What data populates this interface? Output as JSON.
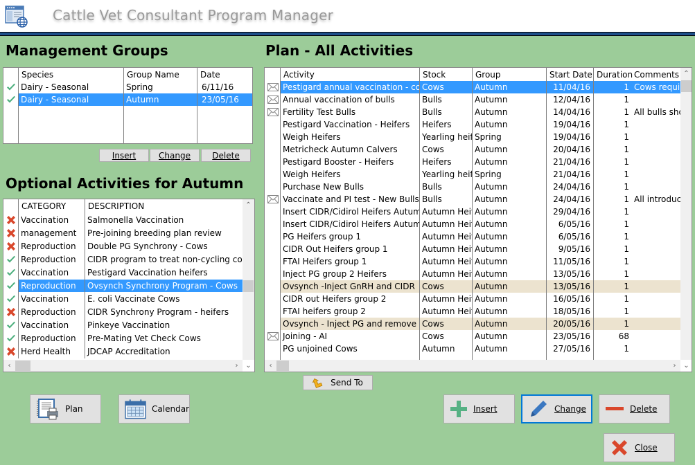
{
  "window": {
    "title": "Cattle Vet Consultant Program Manager",
    "icon": "app-window-globe-icon"
  },
  "colors": {
    "background": "#9ccc99",
    "selection": "#3399ff",
    "highlight_row": "#ece3cf",
    "check_green": "#4caf7d",
    "cross_red": "#d9472b",
    "title_line": "#1d4f8a"
  },
  "management_groups": {
    "title": "Management Groups",
    "columns": [
      "Species",
      "Group Name",
      "Date"
    ],
    "rows": [
      {
        "status": "check",
        "species": "Dairy - Seasonal",
        "group": "Spring",
        "date": "6/11/16",
        "selected": false
      },
      {
        "status": "check",
        "species": "Dairy - Seasonal",
        "group": "Autumn",
        "date": "23/05/16",
        "selected": true
      }
    ],
    "buttons": {
      "insert": "Insert",
      "change": "Change",
      "delete": "Delete"
    }
  },
  "optional_activities": {
    "title": "Optional Activities for Autumn",
    "columns": [
      "CATEGORY",
      "DESCRIPTION"
    ],
    "rows": [
      {
        "status": "cross",
        "category": "Vaccination",
        "description": "Salmonella Vaccination"
      },
      {
        "status": "cross",
        "category": "management",
        "description": "Pre-joining breeding plan review"
      },
      {
        "status": "cross",
        "category": "Reproduction",
        "description": "Double PG Synchrony - Cows"
      },
      {
        "status": "check",
        "category": "Reproduction",
        "description": "CIDR program to treat non-cycling cows"
      },
      {
        "status": "check",
        "category": "Vaccination",
        "description": "Pestigard Vaccination heifers"
      },
      {
        "status": "check",
        "category": "Reproduction",
        "description": "Ovsynch Synchrony Program - Cows",
        "selected": true
      },
      {
        "status": "check",
        "category": "Vaccination",
        "description": "E. coli Vaccinate Cows"
      },
      {
        "status": "cross",
        "category": "Reproduction",
        "description": "CIDR Synchrony Program - heifers"
      },
      {
        "status": "check",
        "category": "Vaccination",
        "description": "Pinkeye Vaccination"
      },
      {
        "status": "check",
        "category": "Reproduction",
        "description": "Pre-Mating Vet Check Cows"
      },
      {
        "status": "cross",
        "category": "Herd Health",
        "description": "JDCAP Accreditation"
      }
    ]
  },
  "plan": {
    "title": "Plan - All Activities",
    "columns": [
      "Activity",
      "Stock",
      "Group",
      "Start Date",
      "Duration",
      "Comments"
    ],
    "rows": [
      {
        "mail": true,
        "activity": "Pestigard annual vaccination - cows",
        "stock": "Cows",
        "group": "Autumn",
        "start": "11/04/16",
        "duration": "1",
        "comments": "Cows require",
        "selected": true
      },
      {
        "mail": true,
        "activity": "Annual vaccination of bulls",
        "stock": "Bulls",
        "group": "Autumn",
        "start": "12/04/16",
        "duration": "1",
        "comments": ""
      },
      {
        "mail": true,
        "activity": "Fertility Test  Bulls",
        "stock": "Bulls",
        "group": "Autumn",
        "start": "14/04/16",
        "duration": "1",
        "comments": "All bulls shou"
      },
      {
        "mail": false,
        "activity": "Pestigard Vaccination - Heifers",
        "stock": "Heifers",
        "group": "Autumn",
        "start": "19/04/16",
        "duration": "1",
        "comments": ""
      },
      {
        "mail": false,
        "activity": "Weigh Heifers",
        "stock": "Yearling heife",
        "group": "Spring",
        "start": "19/04/16",
        "duration": "1",
        "comments": ""
      },
      {
        "mail": false,
        "activity": "Metricheck Autumn Calvers",
        "stock": "Cows",
        "group": "Autumn",
        "start": "20/04/16",
        "duration": "1",
        "comments": ""
      },
      {
        "mail": false,
        "activity": "Pestigard Booster - Heifers",
        "stock": "Heifers",
        "group": "Autumn",
        "start": "21/04/16",
        "duration": "1",
        "comments": ""
      },
      {
        "mail": false,
        "activity": "Weigh Heifers",
        "stock": "Yearling heife",
        "group": "Spring",
        "start": "21/04/16",
        "duration": "1",
        "comments": ""
      },
      {
        "mail": false,
        "activity": "Purchase New Bulls",
        "stock": "Bulls",
        "group": "Autumn",
        "start": "24/04/16",
        "duration": "1",
        "comments": ""
      },
      {
        "mail": true,
        "activity": "Vaccinate and PI test  - New Bulls",
        "stock": "Bulls",
        "group": "Autumn",
        "start": "24/04/16",
        "duration": "1",
        "comments": "All introduce"
      },
      {
        "mail": false,
        "activity": "Insert CIDR/Cidirol Heifers Autumn g",
        "stock": "Autumn Heife",
        "group": "Autumn",
        "start": "29/04/16",
        "duration": "1",
        "comments": ""
      },
      {
        "mail": false,
        "activity": "Insert CIDR/Cidirol Heifers Autumn g",
        "stock": "Autumn Heife",
        "group": "Autumn",
        "start": "6/05/16",
        "duration": "1",
        "comments": ""
      },
      {
        "mail": false,
        "activity": "PG Heifers group 1",
        "stock": "Autumn Heife",
        "group": "Autumn",
        "start": "6/05/16",
        "duration": "1",
        "comments": ""
      },
      {
        "mail": false,
        "activity": "CIDR Out Heifers group 1",
        "stock": "Autumn Heife",
        "group": "Autumn",
        "start": "9/05/16",
        "duration": "1",
        "comments": ""
      },
      {
        "mail": false,
        "activity": "FTAI Heifers group 1",
        "stock": "Autumn Heife",
        "group": "Autumn",
        "start": "11/05/16",
        "duration": "1",
        "comments": ""
      },
      {
        "mail": false,
        "activity": "Inject PG group 2 Heifers",
        "stock": "Autumn Heife",
        "group": "Autumn",
        "start": "13/05/16",
        "duration": "1",
        "comments": ""
      },
      {
        "mail": false,
        "activity": "Ovsynch -Inject GnRH and CIDR",
        "stock": "Cows",
        "group": "Autumn",
        "start": "13/05/16",
        "duration": "1",
        "comments": "",
        "highlight": true
      },
      {
        "mail": false,
        "activity": "CIDR out Heifers group 2",
        "stock": "Autumn Heife",
        "group": "Autumn",
        "start": "16/05/16",
        "duration": "1",
        "comments": ""
      },
      {
        "mail": false,
        "activity": "FTAI heifers group 2",
        "stock": "Autumn Heife",
        "group": "Autumn",
        "start": "18/05/16",
        "duration": "1",
        "comments": ""
      },
      {
        "mail": false,
        "activity": "Ovsynch - Inject PG and remove CII",
        "stock": "Cows",
        "group": "Autumn",
        "start": "20/05/16",
        "duration": "1",
        "comments": "",
        "highlight": true
      },
      {
        "mail": true,
        "activity": "Joining - AI",
        "stock": "Cows",
        "group": "Autumn",
        "start": "23/05/16",
        "duration": "68",
        "comments": ""
      },
      {
        "mail": false,
        "activity": "PG unjoined Cows",
        "stock": "Autumn",
        "group": "Autumn",
        "start": "27/05/16",
        "duration": "1",
        "comments": ""
      }
    ]
  },
  "buttons": {
    "send_to": "Send To",
    "plan": "Plan",
    "calendar": "Calendar",
    "insert": "Insert",
    "change": "Change",
    "delete": "Delete",
    "close": "Close"
  }
}
